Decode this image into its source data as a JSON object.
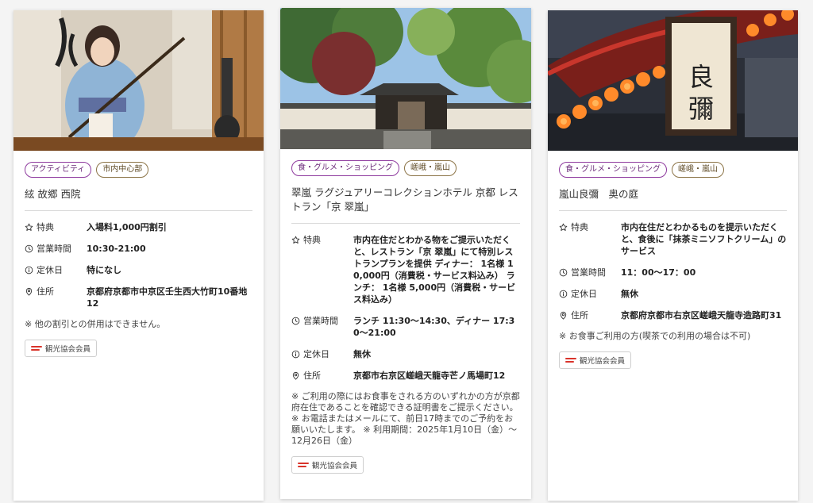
{
  "cards": [
    {
      "photo": "shamisen-player",
      "tags": [
        {
          "label": "アクティビティ",
          "style": "purple"
        },
        {
          "label": "市内中心部",
          "style": "brown"
        }
      ],
      "title": "絃 故郷 西院",
      "rows": [
        {
          "icon": "star-icon",
          "label": "特典",
          "value": "入場料1,000円割引"
        },
        {
          "icon": "clock-icon",
          "label": "営業時間",
          "value": "10:30-21:00"
        },
        {
          "icon": "info-icon",
          "label": "定休日",
          "value": "特になし"
        },
        {
          "icon": "location-pin-icon",
          "label": "住所",
          "value": "京都府京都市中京区壬生西大竹町10番地12"
        }
      ],
      "note": "※ 他の割引との併用はできません。",
      "member_badge": "観光協会会員"
    },
    {
      "photo": "garden-gate",
      "tags": [
        {
          "label": "食・グルメ・ショッピング",
          "style": "purple"
        },
        {
          "label": "嵯峨・嵐山",
          "style": "brown"
        }
      ],
      "title": "翠嵐 ラグジュアリーコレクションホテル 京都 レストラン「京 翠嵐」",
      "rows": [
        {
          "icon": "star-icon",
          "label": "特典",
          "value": "市内在住だとわかる物をご提示いただくと、レストラン「京 翠嵐」にて特別レストランプランを提供 ディナー： 1名様 10,000円（消費税・サービス料込み） ランチ： 1名様 5,000円（消費税・サービス料込み）"
        },
        {
          "icon": "clock-icon",
          "label": "営業時間",
          "value": "ランチ 11:30〜14:30、ディナー 17:30〜21:00"
        },
        {
          "icon": "info-icon",
          "label": "定休日",
          "value": "無休"
        },
        {
          "icon": "location-pin-icon",
          "label": "住所",
          "value": "京都市右京区嵯峨天龍寺芒ノ馬場町12"
        }
      ],
      "note": "※ ご利用の際にはお食事をされる方のいずれかの方が京都府在住であることを確認できる証明書をご提示ください。 ※ お電話またはメールにて、前日17時までのご予約をお願いいたします。 ※ 利用期間：2025年1月10日（金）〜12月26日（金）",
      "member_badge": "観光協会会員"
    },
    {
      "photo": "lantern-signboard",
      "sign_text": "良彌",
      "tags": [
        {
          "label": "食・グルメ・ショッピング",
          "style": "purple"
        },
        {
          "label": "嵯峨・嵐山",
          "style": "brown"
        }
      ],
      "title": "嵐山良彌　奥の庭",
      "rows": [
        {
          "icon": "star-icon",
          "label": "特典",
          "value": "市内在住だとわかるものを提示いただくと、食後に「抹茶ミニソフトクリーム」のサービス"
        },
        {
          "icon": "clock-icon",
          "label": "営業時間",
          "value": "11：00〜17：00"
        },
        {
          "icon": "info-icon",
          "label": "定休日",
          "value": "無休"
        },
        {
          "icon": "location-pin-icon",
          "label": "住所",
          "value": "京都府京都市右京区嵯峨天龍寺造路町31"
        }
      ],
      "note": "※ お食事ご利用の方(喫茶での利用の場合は不可)",
      "member_badge": "観光協会会員"
    }
  ]
}
